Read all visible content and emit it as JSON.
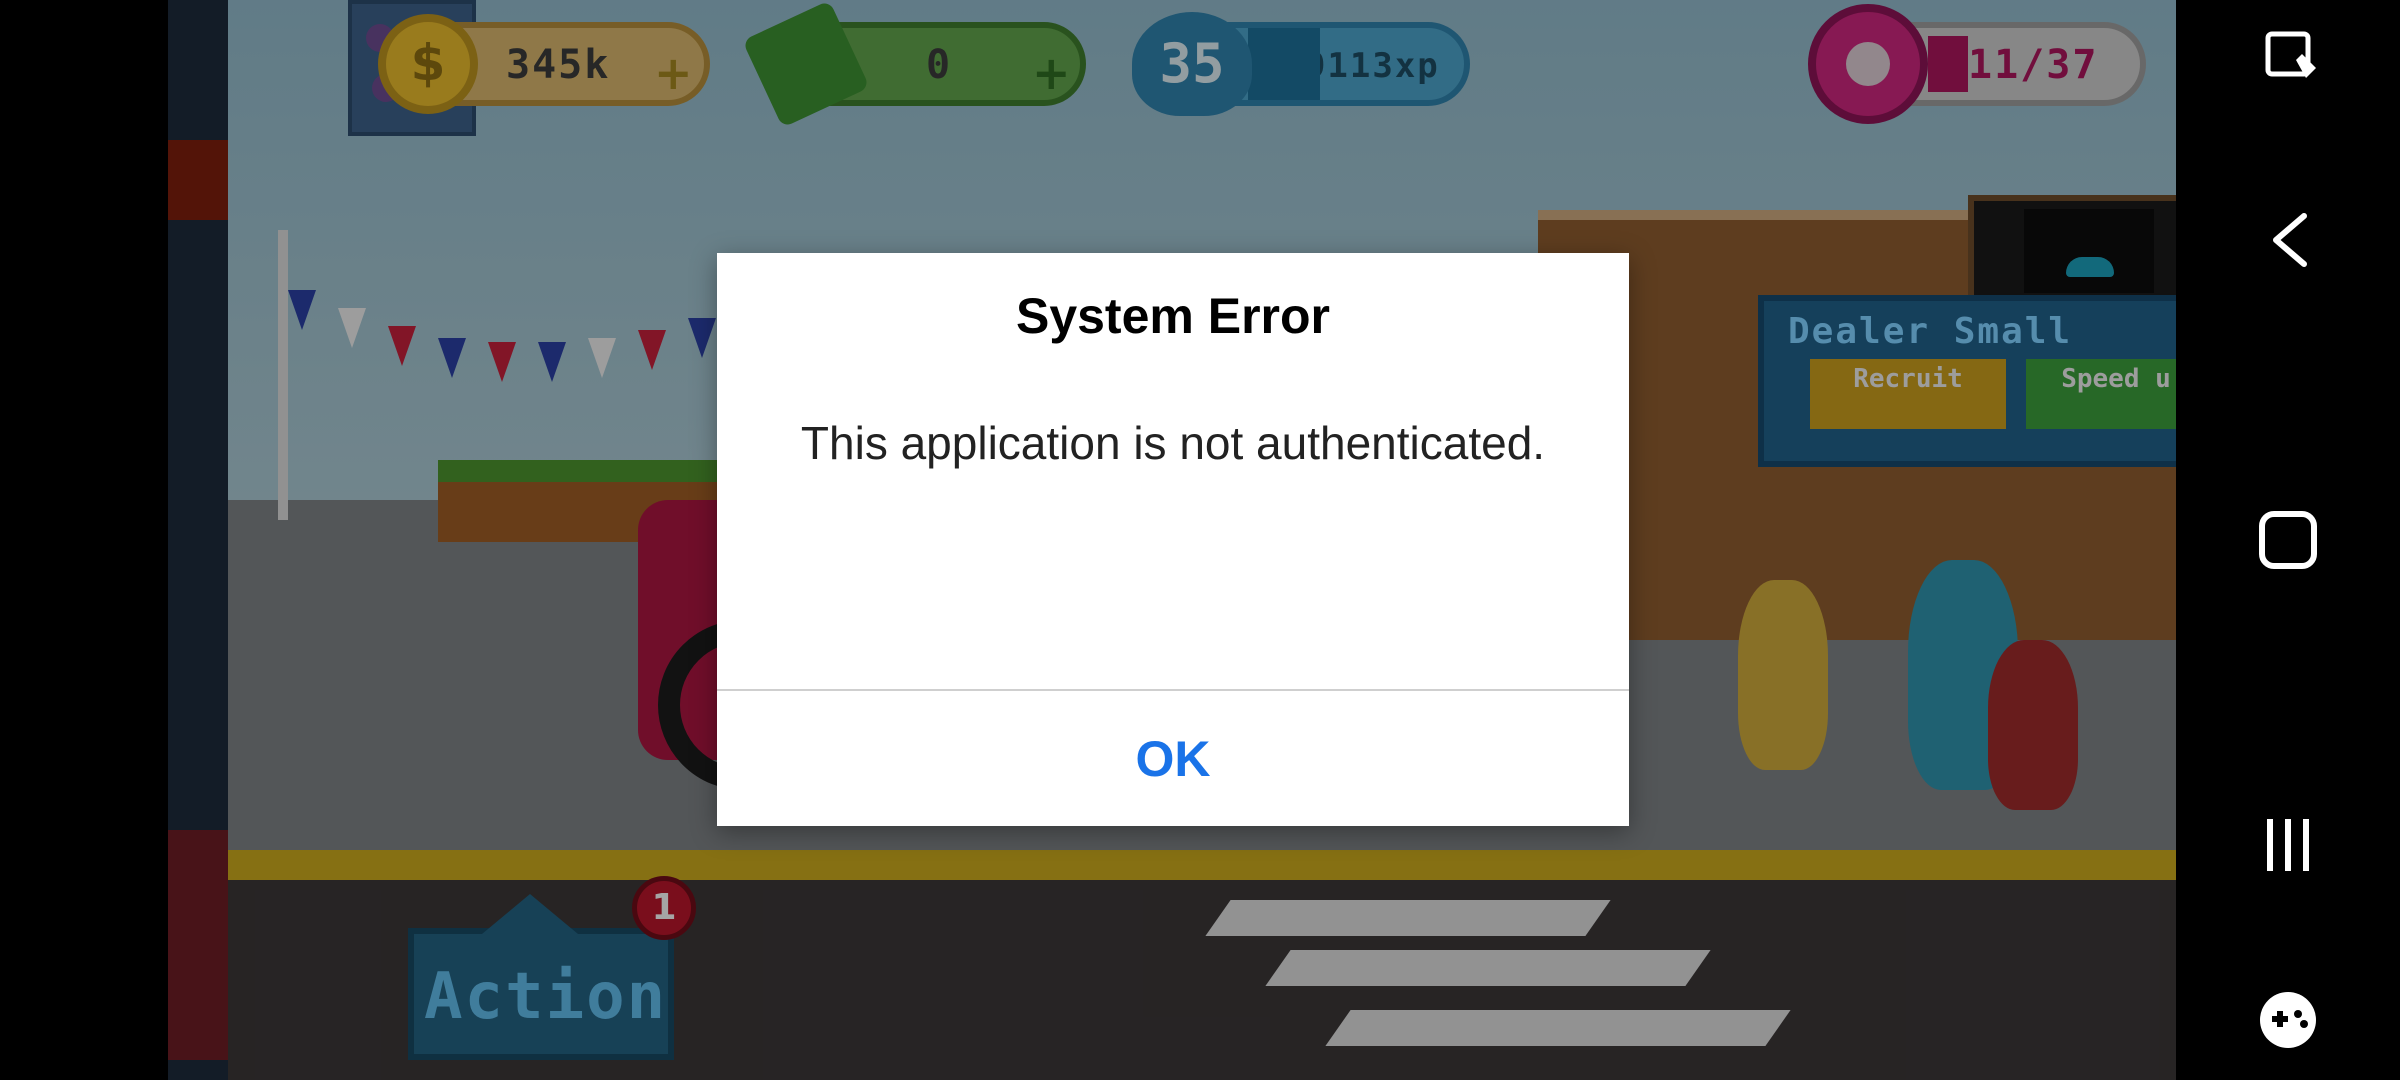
{
  "hud": {
    "coins": "345k",
    "cash": "0",
    "level": "35",
    "xp": "249113xp",
    "donuts": "11/37",
    "plus_symbol": "+",
    "coin_symbol": "$"
  },
  "scene": {
    "shop_title": "Dealer Small",
    "shop_recruit": "Recruit",
    "shop_speed": "Speed u"
  },
  "action_button": {
    "label": "Action",
    "badge_count": "1"
  },
  "dialog": {
    "title": "System Error",
    "message": "This application is not authenticated.",
    "ok_label": "OK"
  },
  "colors": {
    "dialog_button": "#1a73e8",
    "dim_overlay": "rgba(0,0,0,0.32)"
  },
  "navbar": {
    "icons": [
      "touch-lock-icon",
      "back-icon",
      "home-icon",
      "recent-apps-icon",
      "game-tools-icon"
    ]
  }
}
